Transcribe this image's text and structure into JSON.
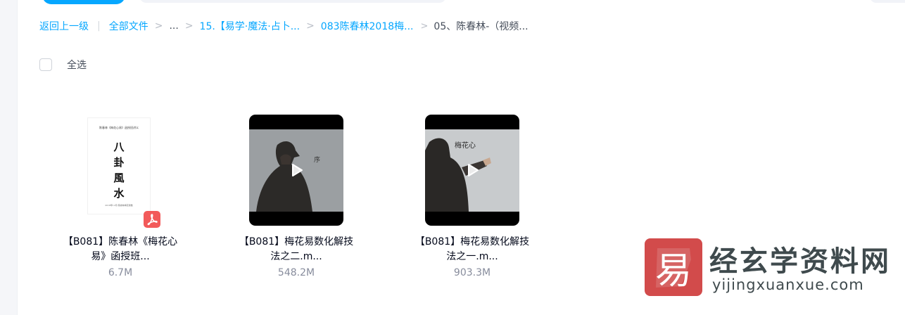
{
  "breadcrumb": {
    "back_label": "返回上一级",
    "all_files_label": "全部文件",
    "ellipsis_label": "...",
    "items": [
      "15.【易学·魔法·占卜...",
      "083陈春林2018梅...",
      "05、陈春林-（视频..."
    ]
  },
  "selection": {
    "select_all_label": "全选"
  },
  "pdf_preview": {
    "header": "陈春林《梅花心易》函授班讲义",
    "title_chars": [
      "八",
      "卦",
      "風",
      "水"
    ],
    "footer": "2018年12月·陈春林梅花易数"
  },
  "files": [
    {
      "name_line1": "【B081】陈春林《梅花心",
      "name_line2": "易》函授班...",
      "size": "6.7M",
      "type": "pdf"
    },
    {
      "name_line1": "【B081】梅花易数化解技",
      "name_line2": "法之二.m...",
      "size": "548.2M",
      "type": "video"
    },
    {
      "name_line1": "【B081】梅花易数化解技",
      "name_line2": "法之一.m...",
      "size": "903.3M",
      "type": "video"
    }
  ],
  "watermark": {
    "logo_char": "易",
    "site_name": "经玄学资料网",
    "url": "yijingxuanxue.com"
  },
  "colors": {
    "accent": "#06a7ff",
    "pdf_badge": "#f25a5a",
    "watermark_red": "#d24b4b"
  },
  "icons": {
    "pdf": "pdf-file-icon",
    "play": "play-icon",
    "checkbox": "checkbox-icon"
  }
}
